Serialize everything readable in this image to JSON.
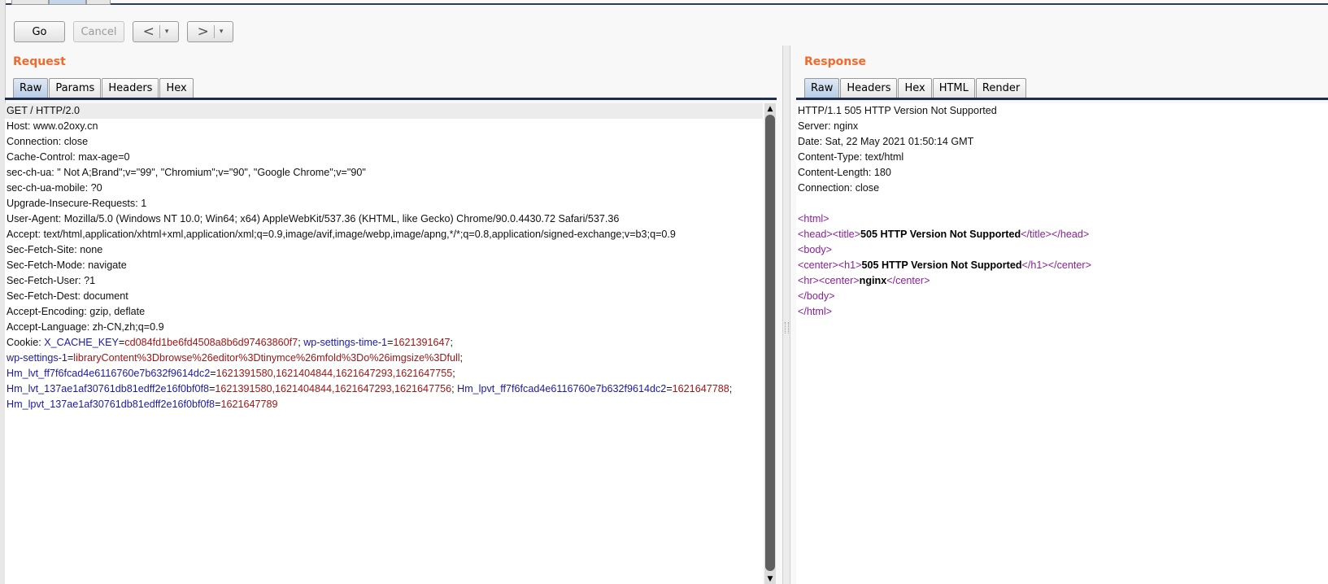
{
  "toolbar": {
    "go_label": "Go",
    "cancel_label": "Cancel",
    "back_arrow": "<",
    "forward_arrow": ">",
    "dropdown_glyph": "▾"
  },
  "request": {
    "title": "Request",
    "tabs": [
      "Raw",
      "Params",
      "Headers",
      "Hex"
    ],
    "active_tab": "Raw",
    "lines": [
      "GET / HTTP/2.0",
      "Host: www.o2oxy.cn",
      "Connection: close",
      "Cache-Control: max-age=0",
      "sec-ch-ua: \" Not A;Brand\";v=\"99\", \"Chromium\";v=\"90\", \"Google Chrome\";v=\"90\"",
      "sec-ch-ua-mobile: ?0",
      "Upgrade-Insecure-Requests: 1",
      "User-Agent: Mozilla/5.0 (Windows NT 10.0; Win64; x64) AppleWebKit/537.36 (KHTML, like Gecko) Chrome/90.0.4430.72 Safari/537.36",
      "Accept: text/html,application/xhtml+xml,application/xml;q=0.9,image/avif,image/webp,image/apng,*/*;q=0.8,application/signed-exchange;v=b3;q=0.9",
      "Sec-Fetch-Site: none",
      "Sec-Fetch-Mode: navigate",
      "Sec-Fetch-User: ?1",
      "Sec-Fetch-Dest: document",
      "Accept-Encoding: gzip, deflate",
      "Accept-Language: zh-CN,zh;q=0.9"
    ],
    "cookie": {
      "label": "Cookie: ",
      "lines": [
        [
          {
            "name": "X_CACHE_KEY",
            "value": "cd084fd1be6fd4508a8b6d97463860f7",
            "sep": "; "
          },
          {
            "name": "wp-settings-time-1",
            "value": "1621391647",
            "sep": ";"
          }
        ],
        [
          {
            "name": "wp-settings-1",
            "value": "libraryContent%3Dbrowse%26editor%3Dtinymce%26mfold%3Do%26imgsize%3Dfull",
            "sep": ";"
          }
        ],
        [
          {
            "name": "Hm_lvt_ff7f6fcad4e6116760e7b632f9614dc2",
            "value": "1621391580,1621404844,1621647293,1621647755",
            "sep": ";"
          }
        ],
        [
          {
            "name": "Hm_lvt_137ae1af30761db81edff2e16f0bf0f8",
            "value": "1621391580,1621404844,1621647293,1621647756",
            "sep": "; "
          },
          {
            "name": "Hm_lpvt_ff7f6fcad4e6116760e7b632f9614dc2",
            "value": "1621647788",
            "sep": ";"
          }
        ],
        [
          {
            "name": "Hm_lpvt_137ae1af30761db81edff2e16f0bf0f8",
            "value": "1621647789",
            "sep": ""
          }
        ]
      ]
    }
  },
  "response": {
    "title": "Response",
    "tabs": [
      "Raw",
      "Headers",
      "Hex",
      "HTML",
      "Render"
    ],
    "active_tab": "Raw",
    "header_lines": [
      "HTTP/1.1 505 HTTP Version Not Supported",
      "Server: nginx",
      "Date: Sat, 22 May 2021 01:50:14 GMT",
      "Content-Type: text/html",
      "Content-Length: 180",
      "Connection: close"
    ],
    "body_lines": [
      [
        {
          "t": "tag",
          "v": "<html>"
        }
      ],
      [
        {
          "t": "tag",
          "v": "<head><title>"
        },
        {
          "t": "strong",
          "v": "505 HTTP Version Not Supported"
        },
        {
          "t": "tag",
          "v": "</title></head>"
        }
      ],
      [
        {
          "t": "tag",
          "v": "<body>"
        }
      ],
      [
        {
          "t": "tag",
          "v": "<center><h1>"
        },
        {
          "t": "strong",
          "v": "505 HTTP Version Not Supported"
        },
        {
          "t": "tag",
          "v": "</h1></center>"
        }
      ],
      [
        {
          "t": "tag",
          "v": "<hr><center>"
        },
        {
          "t": "strong",
          "v": "nginx"
        },
        {
          "t": "tag",
          "v": "</center>"
        }
      ],
      [
        {
          "t": "tag",
          "v": "</body>"
        }
      ],
      [
        {
          "t": "tag",
          "v": "</html>"
        }
      ]
    ]
  },
  "scrollbar": {
    "up_glyph": "▲",
    "down_glyph": "▼"
  },
  "colors": {
    "section_title": "#f06a2e",
    "cookie_name": "#1a1aa6",
    "cookie_value": "#a31515",
    "html_tag": "#8b1f9c"
  }
}
